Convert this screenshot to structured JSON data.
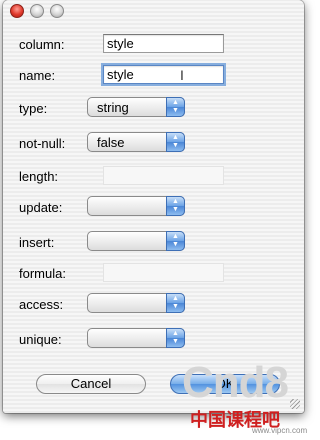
{
  "window": {
    "controls": [
      "close",
      "minimize",
      "zoom"
    ]
  },
  "fields": {
    "column": {
      "label": "column:",
      "value": "style"
    },
    "name": {
      "label": "name:",
      "value": "style"
    },
    "type": {
      "label": "type:",
      "value": "string"
    },
    "not_null": {
      "label": "not-null:",
      "value": "false"
    },
    "length": {
      "label": "length:",
      "value": ""
    },
    "update": {
      "label": "update:",
      "value": ""
    },
    "insert": {
      "label": "insert:",
      "value": ""
    },
    "formula": {
      "label": "formula:",
      "value": ""
    },
    "access": {
      "label": "access:",
      "value": ""
    },
    "unique": {
      "label": "unique:",
      "value": ""
    }
  },
  "buttons": {
    "cancel": "Cancel",
    "ok": "OK"
  },
  "watermark": {
    "logo": "Cnd8",
    "cn": "中国课程吧",
    "url": "www.vipcn.com"
  },
  "colors": {
    "accent": "#5a96e0",
    "close": "#e0392c"
  }
}
